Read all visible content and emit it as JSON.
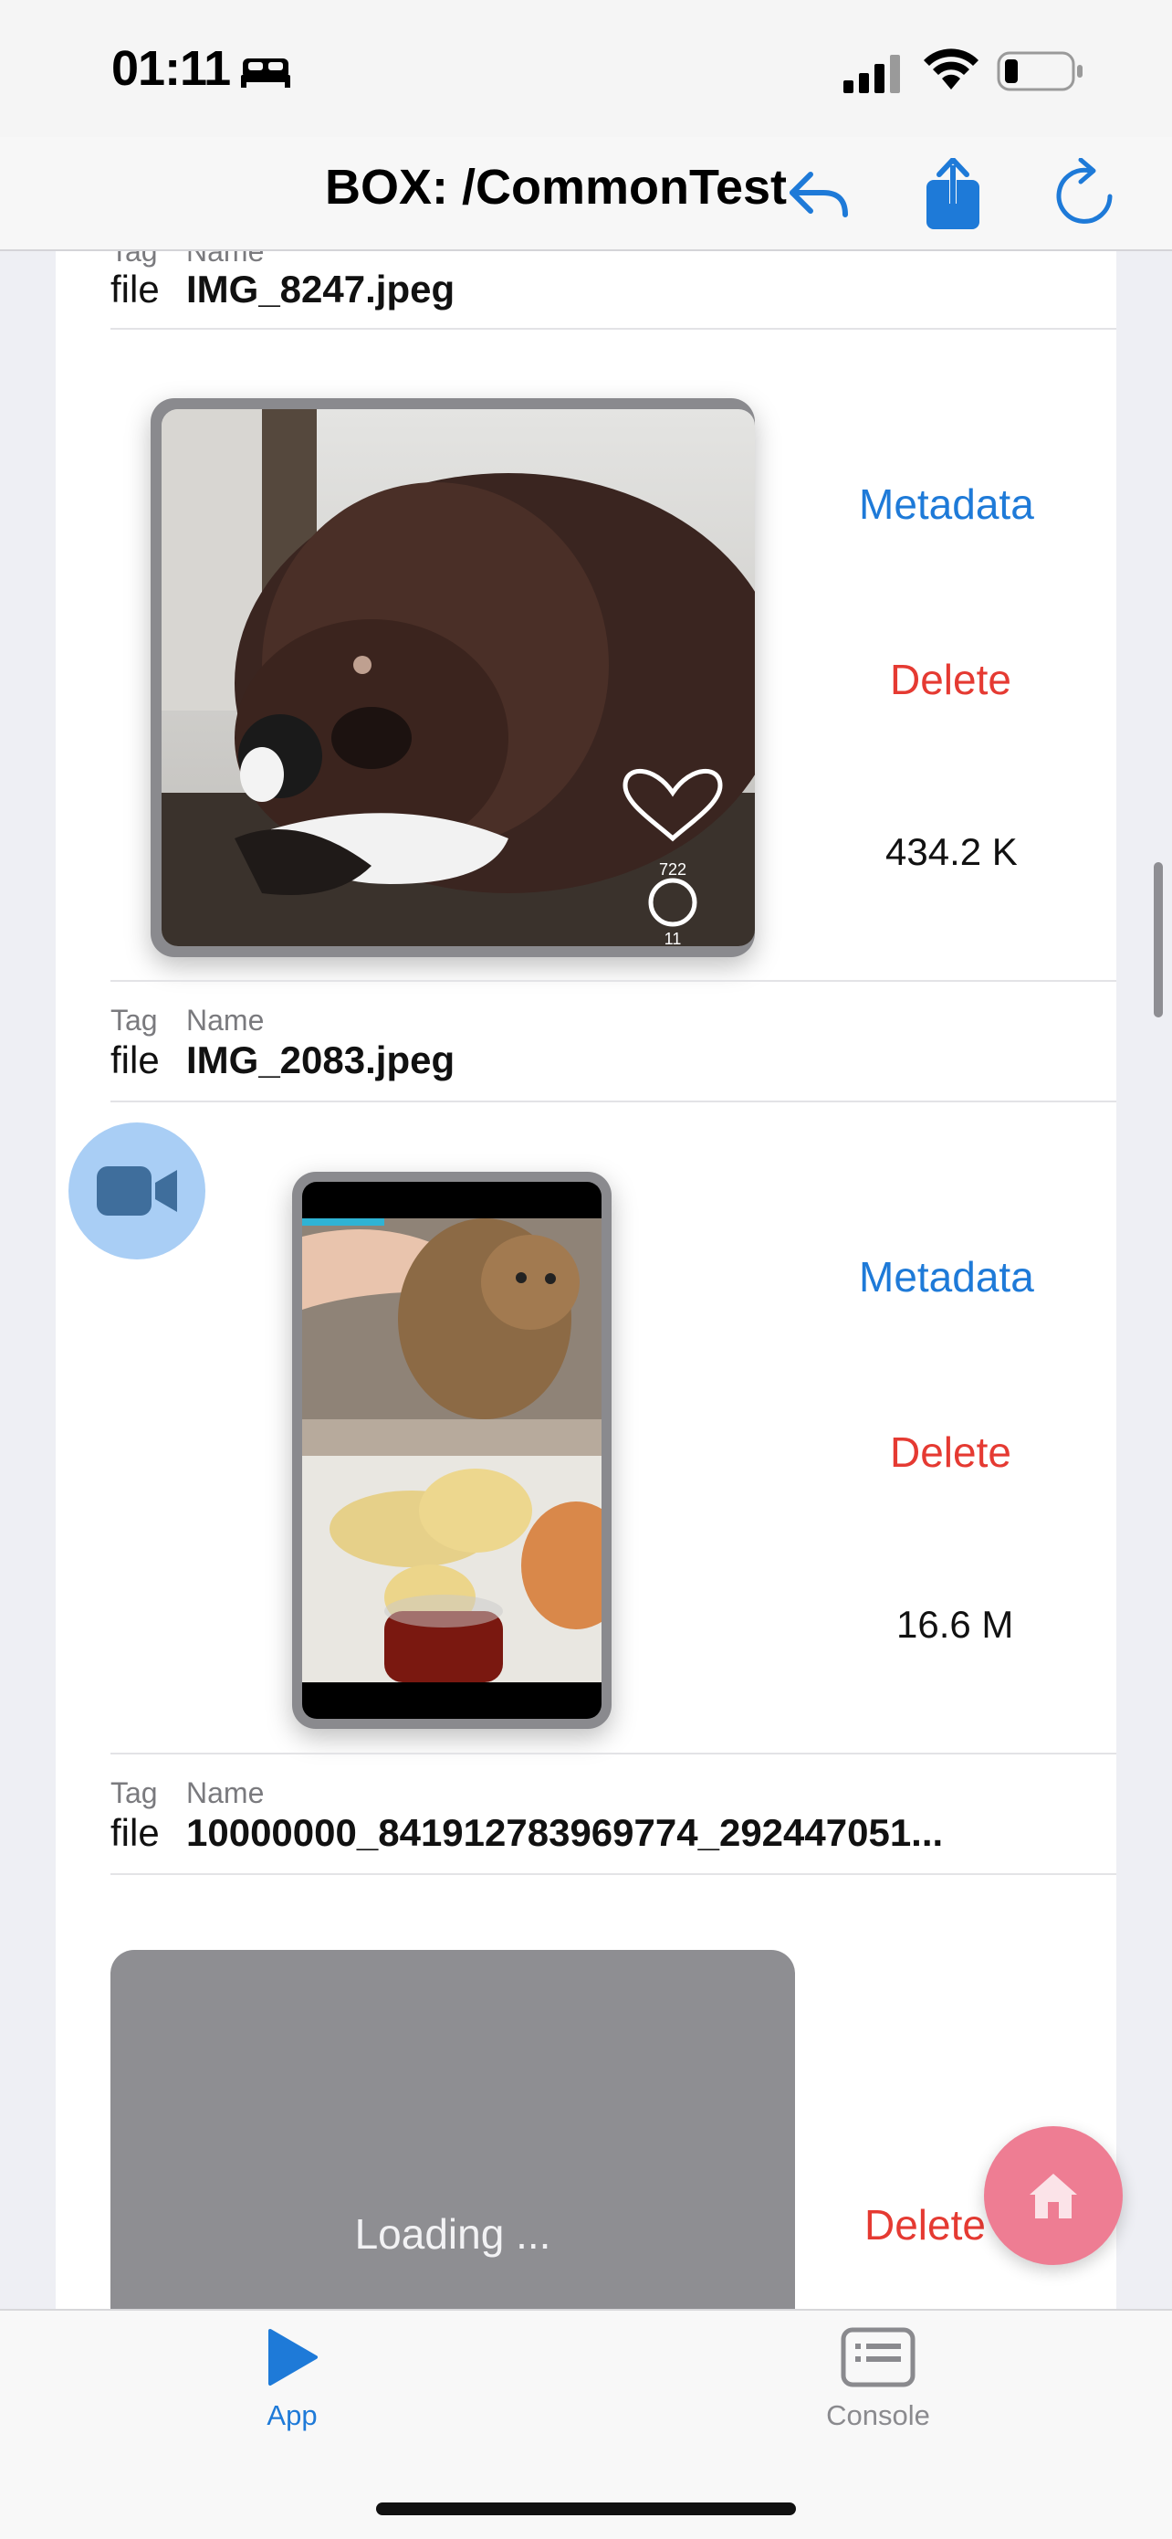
{
  "status": {
    "time": "01:11"
  },
  "nav": {
    "title": "BOX: /CommonTest",
    "icons": [
      "undo-arrow-icon",
      "share-icon",
      "refresh-icon"
    ]
  },
  "list": {
    "tag_caption": "Tag",
    "name_caption": "Name",
    "items": [
      {
        "tag": "file",
        "name": "IMG_8247.jpeg",
        "metadata_label": "Metadata",
        "delete_label": "Delete",
        "size": "434.2 K",
        "thumb_overlay": {
          "likes": "722",
          "comments": "11"
        }
      },
      {
        "tag": "file",
        "name": "IMG_2083.jpeg",
        "metadata_label": "Metadata",
        "delete_label": "Delete",
        "size": "16.6 M"
      },
      {
        "tag": "file",
        "name": "10000000_841912783969774_292447051...",
        "loading_text": "Loading ...",
        "delete_label": "Delete"
      }
    ]
  },
  "fabs": {
    "video": "video-camera-icon",
    "home": "home-icon"
  },
  "tabbar": {
    "tabs": [
      {
        "label": "App",
        "icon": "play-icon",
        "active": true
      },
      {
        "label": "Console",
        "icon": "console-icon",
        "active": false
      }
    ]
  },
  "colors": {
    "accent": "#1e7ad8",
    "danger": "#e53a32",
    "home_fab": "#ee7d93",
    "video_fab": "#a9cef5"
  }
}
